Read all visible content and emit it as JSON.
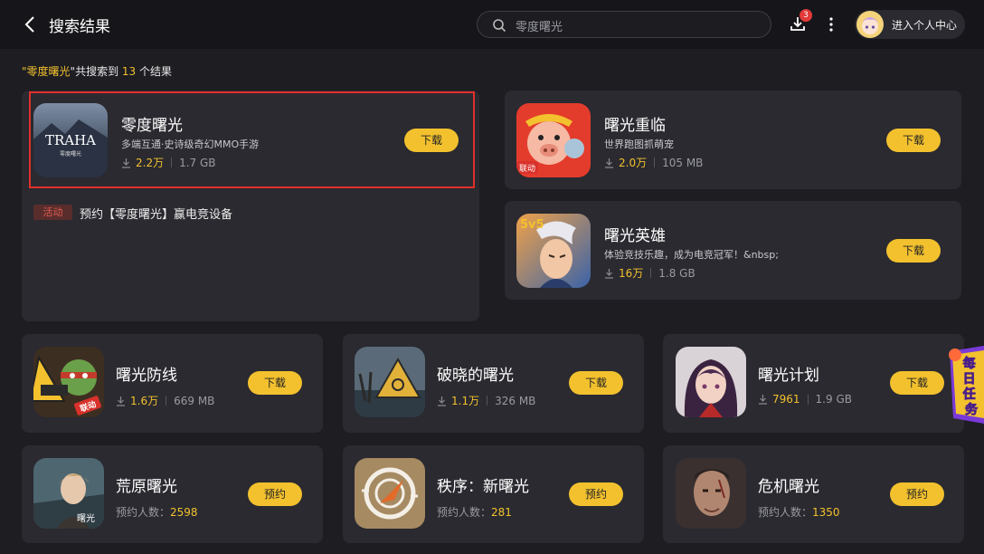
{
  "header": {
    "title": "搜索结果",
    "search_value": "零度曙光",
    "download_badge": "3",
    "profile_label": "进入个人中心"
  },
  "summary": {
    "prefix_quote": "\"",
    "query": "零度曙光",
    "middle": "\"共搜索到 ",
    "count": "13",
    "suffix": " 个结果"
  },
  "featured": {
    "name": "零度曙光",
    "desc": "多端互通·史诗级奇幻MMO手游",
    "downloads": "2.2万",
    "size": "1.7 GB",
    "button": "下载",
    "icon": "traha-icon",
    "icon_text": "TRAHA",
    "icon_subtext": "零度曙光",
    "activity_tag": "活动",
    "activity_text": "预约【零度曙光】赢电竞设备"
  },
  "side_cards": [
    {
      "name": "曙光重临",
      "desc": "世界跑图抓萌宠",
      "downloads": "2.0万",
      "size": "105 MB",
      "button": "下载",
      "icon": "pig-icon",
      "icon_tag": "联动"
    },
    {
      "name": "曙光英雄",
      "desc": "体验竞技乐趣，成为电竞冠军！&nbsp;",
      "downloads": "16万",
      "size": "1.8 GB",
      "button": "下载",
      "icon": "hero-icon",
      "icon_tag": "5v5"
    }
  ],
  "grid_row1": [
    {
      "name": "曙光防线",
      "downloads": "1.6万",
      "size": "669 MB",
      "button": "下载",
      "icon": "turtle-icon",
      "icon_tag": "联动"
    },
    {
      "name": "破晓的曙光",
      "downloads": "1.1万",
      "size": "326 MB",
      "button": "下载",
      "icon": "biohazard-icon"
    },
    {
      "name": "曙光计划",
      "downloads": "7961",
      "size": "1.9 GB",
      "button": "下载",
      "icon": "girl-icon"
    }
  ],
  "grid_row2": [
    {
      "name": "荒原曙光",
      "reserve_label": "预约人数：",
      "reserve_count": "2598",
      "button": "预约",
      "icon": "wasteland-icon",
      "icon_tag": "曙光"
    },
    {
      "name": "秩序：新曙光",
      "reserve_label": "预约人数：",
      "reserve_count": "281",
      "button": "预约",
      "icon": "compass-icon"
    },
    {
      "name": "危机曙光",
      "reserve_label": "预约人数：",
      "reserve_count": "1350",
      "button": "预约",
      "icon": "soldier-icon"
    }
  ],
  "daily_task": {
    "label": "每日任务"
  },
  "colors": {
    "accent": "#f3c12e",
    "card": "#2a2a30",
    "background": "#1d1d22",
    "highlight": "#e0302a"
  }
}
